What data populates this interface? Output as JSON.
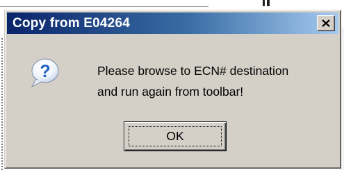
{
  "dialog": {
    "title": "Copy from E04264",
    "close_icon": "close-icon",
    "icon": "question-icon",
    "message_lines": [
      "Please browse to ECN# destination",
      "and run again from toolbar!"
    ],
    "ok_label": "OK"
  },
  "colors": {
    "titlebar_start": "#0a246a",
    "titlebar_end": "#a6caf0",
    "face": "#d4d0c8",
    "icon_blue": "#1f5fbf"
  }
}
